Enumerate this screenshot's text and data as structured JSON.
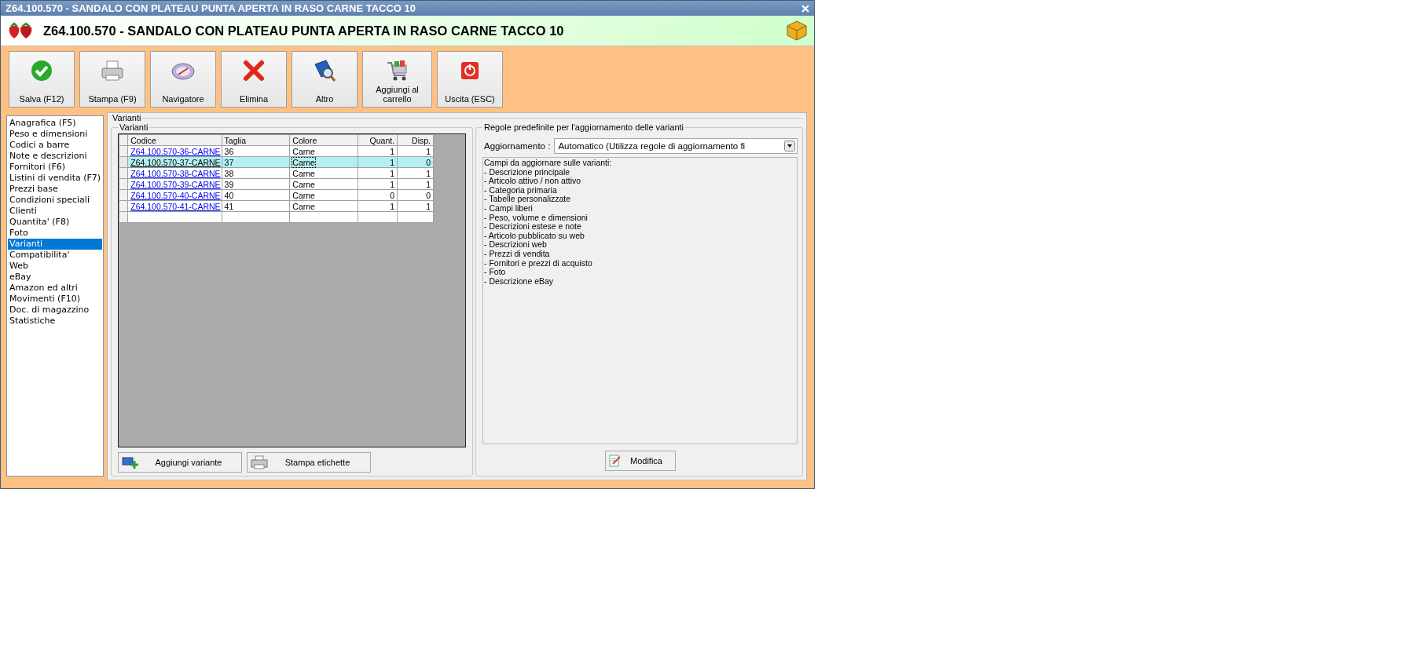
{
  "window": {
    "title": "Z64.100.570 - SANDALO CON PLATEAU PUNTA APERTA IN RASO CARNE TACCO 10"
  },
  "header": {
    "title": "Z64.100.570 - SANDALO CON PLATEAU PUNTA APERTA IN RASO CARNE TACCO 10"
  },
  "toolbar": [
    {
      "label": "Salva (F12)"
    },
    {
      "label": "Stampa (F9)"
    },
    {
      "label": "Navigatore"
    },
    {
      "label": "Elimina"
    },
    {
      "label": "Altro"
    },
    {
      "label": "Aggiungi al carrello"
    },
    {
      "label": "Uscita (ESC)"
    }
  ],
  "sidebar": {
    "items": [
      {
        "label": "Anagrafica (F5)",
        "selected": false
      },
      {
        "label": "Peso e dimensioni",
        "selected": false
      },
      {
        "label": "Codici a barre",
        "selected": false
      },
      {
        "label": "Note e descrizioni",
        "selected": false
      },
      {
        "label": "Fornitori (F6)",
        "selected": false
      },
      {
        "label": "Listini di vendita (F7)",
        "selected": false
      },
      {
        "label": "Prezzi base",
        "selected": false
      },
      {
        "label": "Condizioni speciali",
        "selected": false
      },
      {
        "label": "Clienti",
        "selected": false
      },
      {
        "label": "Quantita' (F8)",
        "selected": false
      },
      {
        "label": "Foto",
        "selected": false
      },
      {
        "label": "Varianti",
        "selected": true
      },
      {
        "label": "Compatibilita'",
        "selected": false
      },
      {
        "label": "Web",
        "selected": false
      },
      {
        "label": "eBay",
        "selected": false
      },
      {
        "label": "Amazon ed altri",
        "selected": false
      },
      {
        "label": "Movimenti (F10)",
        "selected": false
      },
      {
        "label": "Doc. di magazzino",
        "selected": false
      },
      {
        "label": "Statistiche",
        "selected": false
      }
    ]
  },
  "panel": {
    "title": "Varianti",
    "variants_group": {
      "title": "Varianti",
      "table": {
        "columns": [
          "Codice",
          "Taglia",
          "Colore",
          "Quant.",
          "Disp."
        ],
        "rows": [
          {
            "codice": "Z64.100.570-36-CARNE",
            "taglia": "36",
            "colore": "Carne",
            "quant": "1",
            "disp": "1",
            "selected": false
          },
          {
            "codice": "Z64.100.570-37-CARNE",
            "taglia": "37",
            "colore": "Carne",
            "quant": "1",
            "disp": "0",
            "selected": true
          },
          {
            "codice": "Z64.100.570-38-CARNE",
            "taglia": "38",
            "colore": "Carne",
            "quant": "1",
            "disp": "1",
            "selected": false
          },
          {
            "codice": "Z64.100.570-39-CARNE",
            "taglia": "39",
            "colore": "Carne",
            "quant": "1",
            "disp": "1",
            "selected": false
          },
          {
            "codice": "Z64.100.570-40-CARNE",
            "taglia": "40",
            "colore": "Carne",
            "quant": "0",
            "disp": "0",
            "selected": false
          },
          {
            "codice": "Z64.100.570-41-CARNE",
            "taglia": "41",
            "colore": "Carne",
            "quant": "1",
            "disp": "1",
            "selected": false
          }
        ]
      },
      "buttons": [
        {
          "label": "Aggiungi variante"
        },
        {
          "label": "Stampa etichette"
        }
      ]
    },
    "rules_group": {
      "title": "Regole predefinite per l'aggiornamento delle varianti",
      "field_label": "Aggiornamento :",
      "dropdown_value": "Automatico (Utilizza regole di aggiornamento fi",
      "memo_lines": [
        "Campi da aggiornare sulle varianti:",
        "- Descrizione principale",
        "- Articolo attivo / non attivo",
        "- Categoria primaria",
        "- Tabelle personalizzate",
        "- Campi liberi",
        "- Peso, volume e dimensioni",
        "- Descrizioni estese e note",
        "- Articolo pubblicato su web",
        "- Descrizioni web",
        "- Prezzi di vendita",
        "- Fornitori e prezzi di acquisto",
        "- Foto",
        "- Descrizione eBay"
      ],
      "button": {
        "label": "Modifica"
      }
    }
  }
}
